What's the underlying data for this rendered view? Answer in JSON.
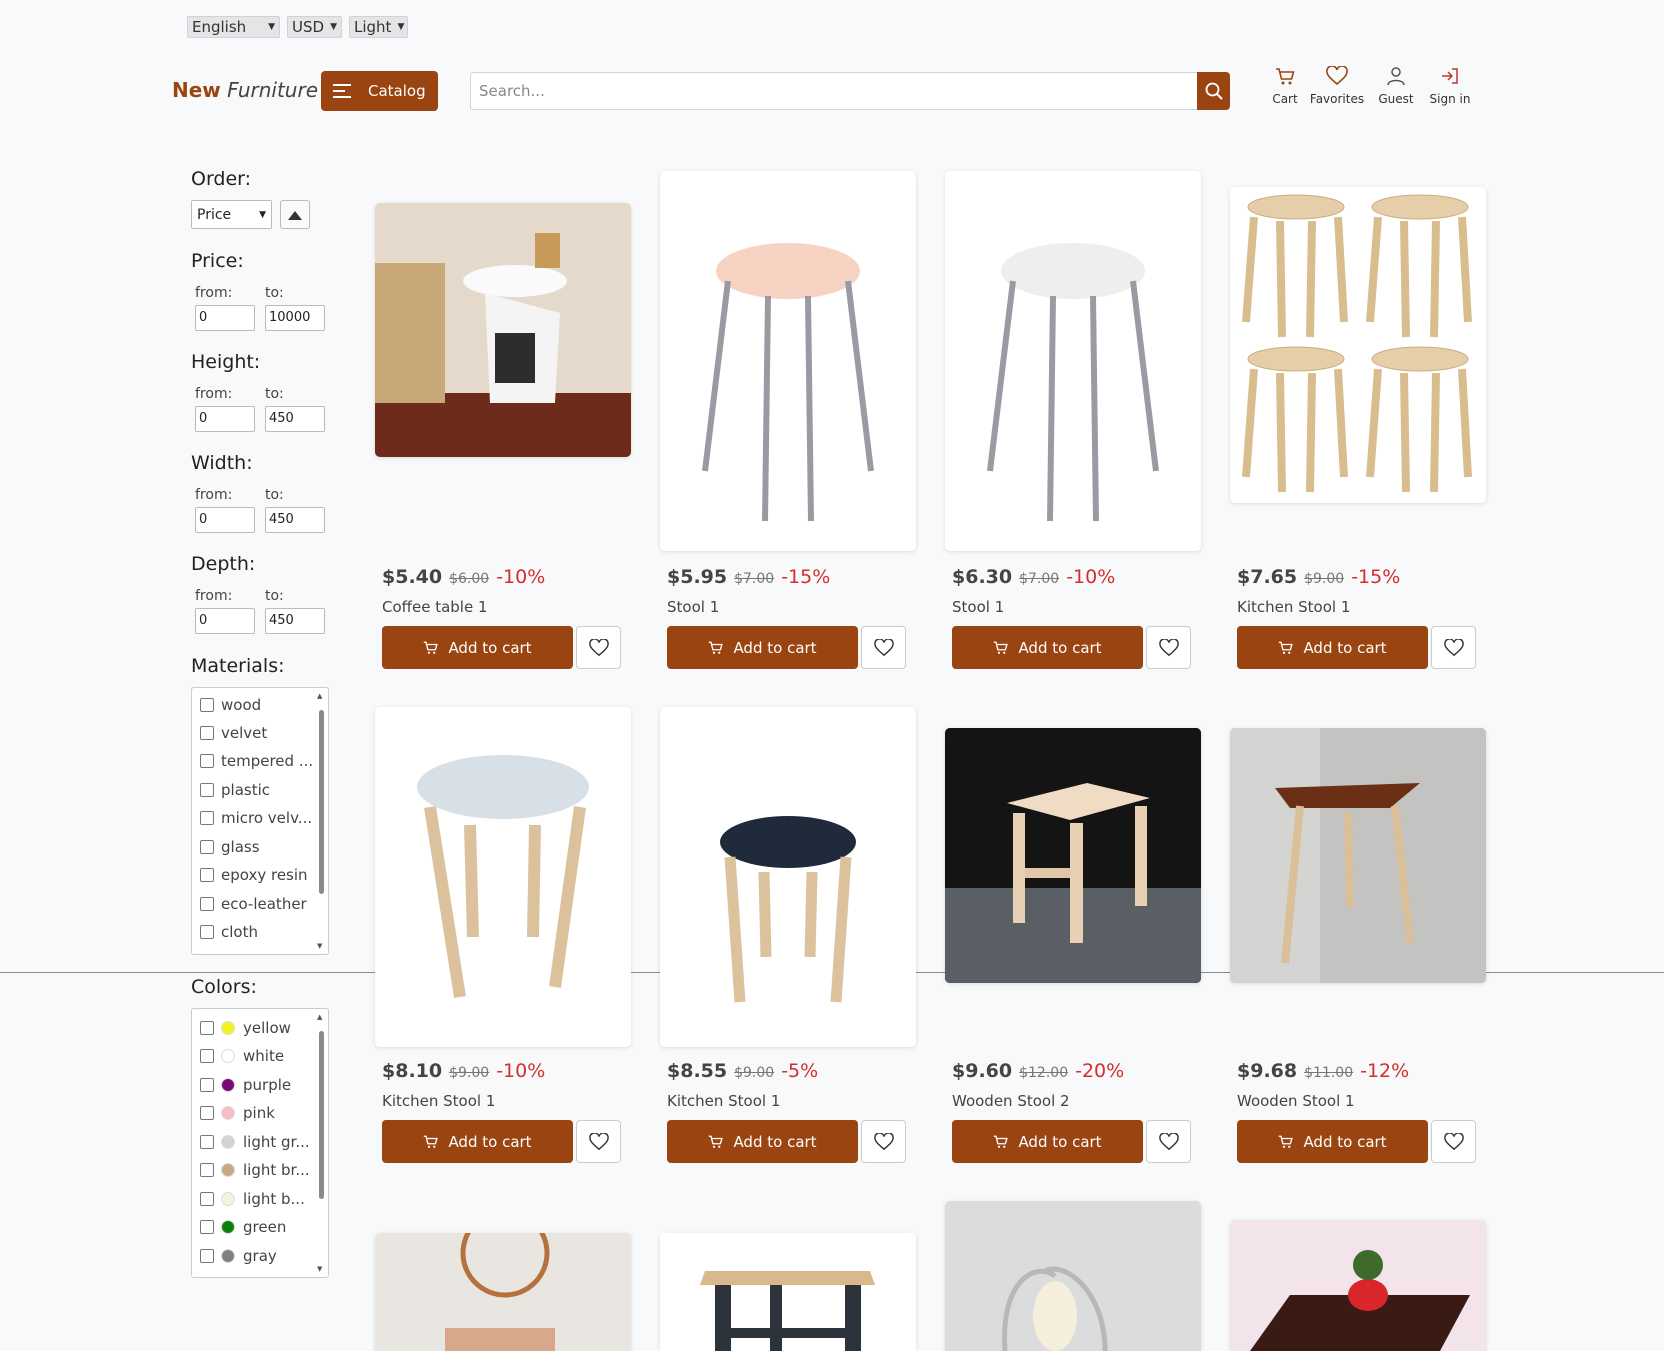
{
  "topbar": {
    "language": "English",
    "currency": "USD",
    "theme": "Light"
  },
  "header": {
    "logo_new": "New",
    "logo_furniture": "Furniture",
    "catalog_label": "Catalog",
    "search_placeholder": "Search...",
    "links": {
      "cart": "Cart",
      "favorites": "Favorites",
      "guest": "Guest",
      "signin": "Sign in"
    }
  },
  "filters": {
    "order_title": "Order:",
    "order_value": "Price",
    "price_title": "Price:",
    "height_title": "Height:",
    "width_title": "Width:",
    "depth_title": "Depth:",
    "from_label": "from:",
    "to_label": "to:",
    "price_from": "0",
    "price_to": "10000",
    "height_from": "0",
    "height_to": "450",
    "width_from": "0",
    "width_to": "450",
    "depth_from": "0",
    "depth_to": "450",
    "materials_title": "Materials:",
    "materials": [
      "wood",
      "velvet",
      "tempered ...",
      "plastic",
      "micro velv...",
      "glass",
      "epoxy resin",
      "eco-leather",
      "cloth"
    ],
    "colors_title": "Colors:",
    "colors": [
      {
        "name": "yellow",
        "hex": "#f2f21a"
      },
      {
        "name": "white",
        "hex": "#ffffff"
      },
      {
        "name": "purple",
        "hex": "#7a0a7a"
      },
      {
        "name": "pink",
        "hex": "#f7bcc6"
      },
      {
        "name": "light gr...",
        "hex": "#d3d3d3"
      },
      {
        "name": "light br...",
        "hex": "#c9a882"
      },
      {
        "name": "light b...",
        "hex": "#f6f3dc"
      },
      {
        "name": "green",
        "hex": "#0a800a"
      },
      {
        "name": "gray",
        "hex": "#808080"
      }
    ]
  },
  "products": [
    {
      "price": "$5.40",
      "old": "$6.00",
      "disc": "-10%",
      "name": "Coffee table 1"
    },
    {
      "price": "$5.95",
      "old": "$7.00",
      "disc": "-15%",
      "name": "Stool 1"
    },
    {
      "price": "$6.30",
      "old": "$7.00",
      "disc": "-10%",
      "name": "Stool 1"
    },
    {
      "price": "$7.65",
      "old": "$9.00",
      "disc": "-15%",
      "name": "Kitchen Stool 1"
    },
    {
      "price": "$8.10",
      "old": "$9.00",
      "disc": "-10%",
      "name": "Kitchen Stool 1"
    },
    {
      "price": "$8.55",
      "old": "$9.00",
      "disc": "-5%",
      "name": "Kitchen Stool 1"
    },
    {
      "price": "$9.60",
      "old": "$12.00",
      "disc": "-20%",
      "name": "Wooden Stool 2"
    },
    {
      "price": "$9.68",
      "old": "$11.00",
      "disc": "-12%",
      "name": "Wooden Stool 1"
    }
  ],
  "add_to_cart_label": "Add to cart",
  "brand_color": "#9a4412",
  "discount_color": "#d62d2d"
}
